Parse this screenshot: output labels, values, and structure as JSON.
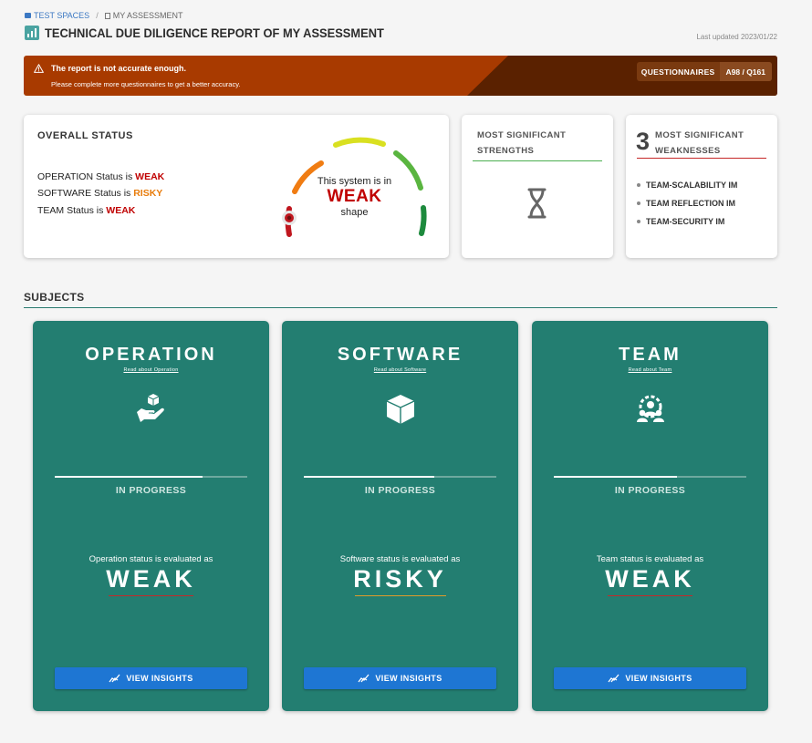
{
  "breadcrumb": {
    "space": "TEST SPACES",
    "separator": "/",
    "current": "MY ASSESSMENT"
  },
  "page": {
    "title": "TECHNICAL DUE DILIGENCE REPORT OF MY ASSESSMENT",
    "last_updated": "Last updated 2023/01/22"
  },
  "alert": {
    "title": "The report is not accurate enough.",
    "message": "Please complete more questionnaires to get a better accuracy.",
    "badge_label": "QUESTIONNAIRES",
    "badge_value": "A98 / Q161"
  },
  "overall": {
    "title": "OVERALL STATUS",
    "lines": [
      {
        "prefix": "OPERATION Status is",
        "status": "WEAK"
      },
      {
        "prefix": "SOFTWARE Status is",
        "status": "RISKY"
      },
      {
        "prefix": "TEAM Status is",
        "status": "WEAK"
      }
    ],
    "gauge_line1": "This system is in",
    "gauge_status": "WEAK",
    "gauge_line3": "shape"
  },
  "strengths": {
    "title_line1": "MOST SIGNIFICANT",
    "title_line2": "STRENGTHS",
    "icon": "hourglass-icon"
  },
  "weaknesses": {
    "count": "3",
    "title_line1": "MOST SIGNIFICANT",
    "title_line2": "WEAKNESSES",
    "items": [
      "TEAM-SCALABILITY IM",
      "TEAM REFLECTION IM",
      "TEAM-SECURITY IM"
    ]
  },
  "subjects_heading": "SUBJECTS",
  "subjects": [
    {
      "name": "OPERATION",
      "read_link": "Read about Operation",
      "icon": "hand-box-icon",
      "progress": 0.77,
      "progress_label": "IN PROGRESS",
      "eval_text": "Operation status is evaluated as",
      "status": "WEAK",
      "button": "VIEW INSIGHTS"
    },
    {
      "name": "SOFTWARE",
      "read_link": "Read about Software",
      "icon": "cube-icon",
      "progress": 0.68,
      "progress_label": "IN PROGRESS",
      "eval_text": "Software status is evaluated as",
      "status": "RISKY",
      "button": "VIEW INSIGHTS"
    },
    {
      "name": "TEAM",
      "read_link": "Read about Team",
      "icon": "team-icon",
      "progress": 0.64,
      "progress_label": "IN PROGRESS",
      "eval_text": "Team status is evaluated as",
      "status": "WEAK",
      "button": "VIEW INSIGHTS"
    }
  ],
  "colors": {
    "teal": "#237e71",
    "weak": "#c00000",
    "risky": "#e87c0c",
    "alert": "#a83a00",
    "button": "#1e76d3"
  }
}
